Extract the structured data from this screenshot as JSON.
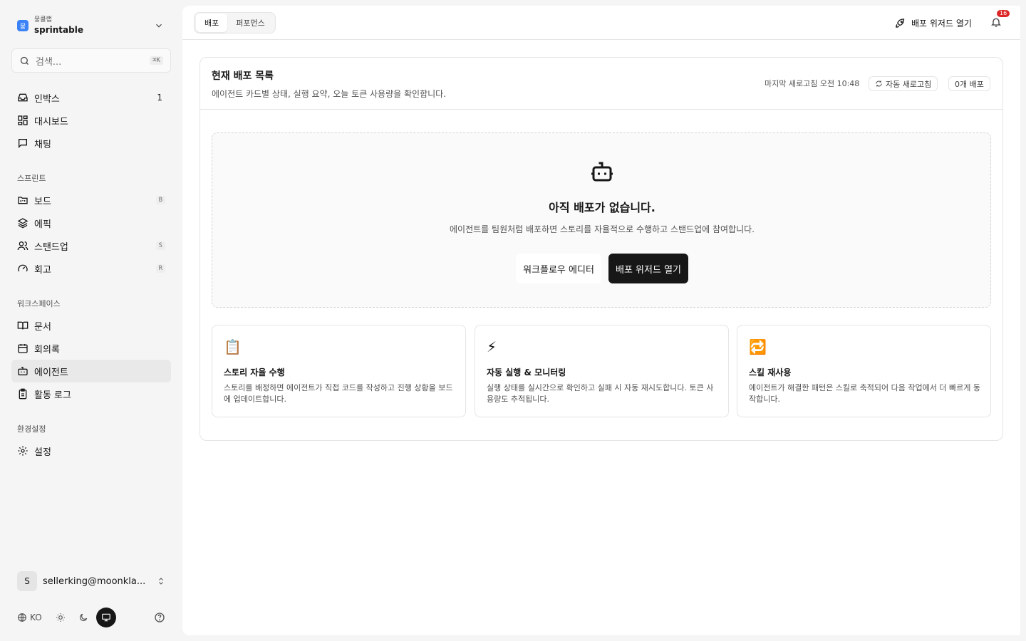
{
  "workspace": {
    "org": "뭉클랩",
    "name": "sprintable",
    "logo_letter": "뭉"
  },
  "search": {
    "placeholder": "검색...",
    "shortcut": "⌘K"
  },
  "nav_top": [
    {
      "label": "인박스",
      "count": "1",
      "icon": "inbox-icon"
    },
    {
      "label": "대시보드",
      "icon": "dashboard-icon"
    },
    {
      "label": "채팅",
      "icon": "chat-icon"
    }
  ],
  "sections": {
    "sprint": "스프린트",
    "workspace": "워크스페이스",
    "settings": "환경설정"
  },
  "nav_sprint": [
    {
      "label": "보드",
      "shortcut": "B",
      "icon": "board-icon"
    },
    {
      "label": "에픽",
      "icon": "layers-icon"
    },
    {
      "label": "스탠드업",
      "shortcut": "S",
      "icon": "users-icon"
    },
    {
      "label": "회고",
      "shortcut": "R",
      "icon": "gauge-icon"
    }
  ],
  "nav_workspace": [
    {
      "label": "문서",
      "icon": "book-icon"
    },
    {
      "label": "회의록",
      "icon": "calendar-icon"
    },
    {
      "label": "에이전트",
      "icon": "bot-icon",
      "active": true
    },
    {
      "label": "활동 로그",
      "icon": "clipboard-icon"
    }
  ],
  "nav_settings": [
    {
      "label": "설정",
      "icon": "gear-icon"
    }
  ],
  "user": {
    "initial": "S",
    "email": "sellerking@moonkla..."
  },
  "bottom": {
    "lang": "KO"
  },
  "topbar": {
    "tabs": [
      {
        "label": "배포",
        "active": true
      },
      {
        "label": "퍼포먼스"
      }
    ],
    "wizard_label": "배포 위저드 열기",
    "notification_count": "16"
  },
  "card": {
    "title": "현재 배포 목록",
    "description": "에이전트 카드별 상태, 실행 요약, 오늘 토큰 사용량을 확인합니다.",
    "refresh_info": "마지막 새로고침 오전 10:48",
    "auto_refresh_label": "자동 새로고침",
    "deploy_count_label": "0개 배포"
  },
  "empty_state": {
    "title": "아직 배포가 없습니다.",
    "description": "에이전트를 팀원처럼 배포하면 스토리를 자율적으로 수행하고 스탠드업에 참여합니다.",
    "secondary_button": "워크플로우 에디터",
    "primary_button": "배포 위저드 열기"
  },
  "features": [
    {
      "emoji": "📋",
      "title": "스토리 자율 수행",
      "description": "스토리를 배정하면 에이전트가 직접 코드를 작성하고 진행 상황을 보드에 업데이트합니다."
    },
    {
      "emoji": "⚡",
      "title": "자동 실행 & 모니터링",
      "description": "실행 상태를 실시간으로 확인하고 실패 시 자동 재시도합니다. 토큰 사용량도 추적됩니다."
    },
    {
      "emoji": "🔁",
      "title": "스킬 재사용",
      "description": "에이전트가 해결한 패턴은 스킬로 축적되어 다음 작업에서 더 빠르게 동작합니다."
    }
  ]
}
